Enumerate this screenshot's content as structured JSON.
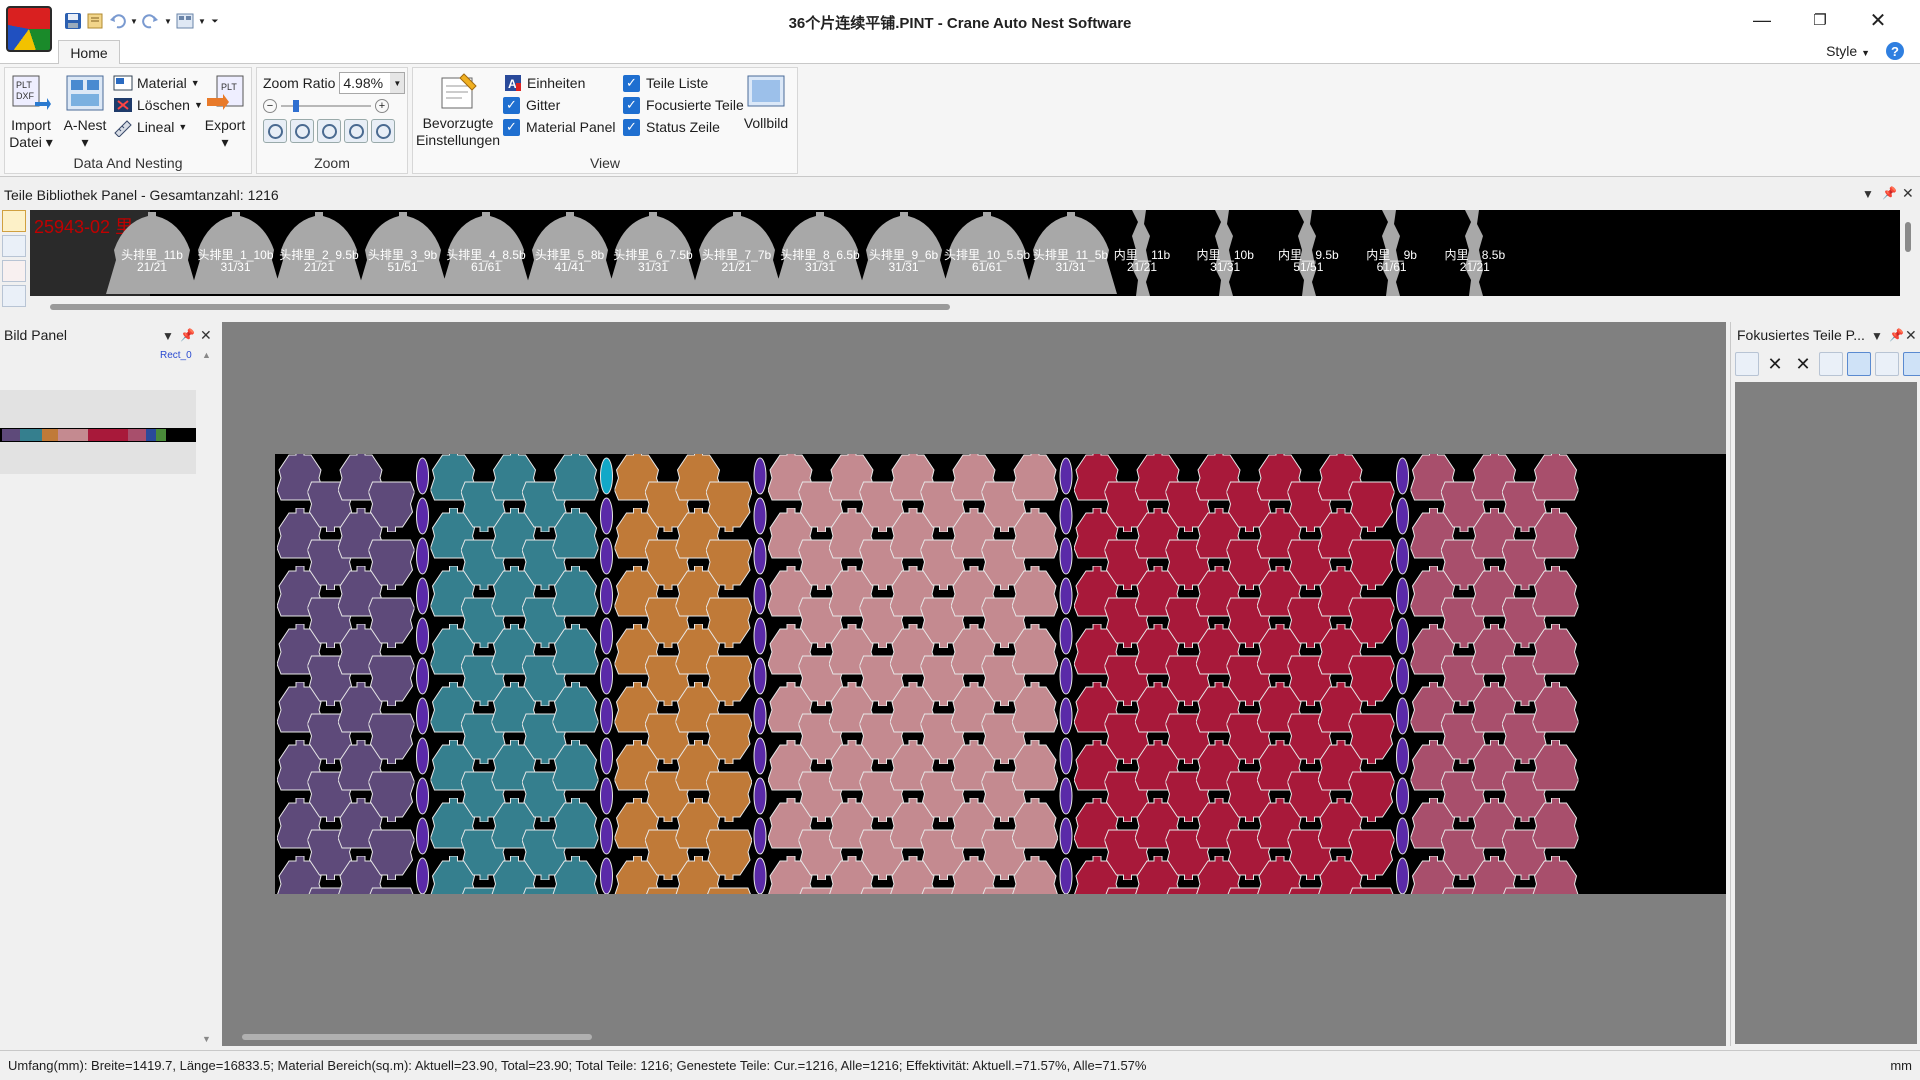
{
  "window": {
    "title": "36个片连续平铺.PINT - Crane Auto Nest Software"
  },
  "ribbon": {
    "tab": "Home",
    "style_label": "Style",
    "data_nesting": {
      "label": "Data And Nesting",
      "import_line1": "Import",
      "import_line2": "Datei",
      "anest": "A-Nest",
      "material": "Material",
      "loeschen": "Löschen",
      "lineal": "Lineal",
      "export": "Export"
    },
    "zoom": {
      "label": "Zoom",
      "ratio_label": "Zoom Ratio",
      "ratio_value": "4.98%"
    },
    "view": {
      "label": "View",
      "bevorzugte_line1": "Bevorzugte",
      "bevorzugte_line2": "Einstellungen",
      "einheiten": "Einheiten",
      "gitter": "Gitter",
      "material_panel": "Material Panel",
      "teile_liste": "Teile Liste",
      "focusierte_teile": "Focusierte Teile",
      "status_zeile": "Status Zeile",
      "vollbild": "Vollbild",
      "checked": {
        "gitter": true,
        "material_panel": true,
        "teile_liste": true,
        "focusierte_teile": true,
        "status_zeile": true
      }
    }
  },
  "parts_panel": {
    "title": "Teile Bibliothek Panel - Gesamtanzahl: 1216",
    "header_label": "25943-02 里",
    "parts": [
      {
        "name": "头排里_11b",
        "count": "21/21",
        "shape": "bell"
      },
      {
        "name": "头排里_1_10b",
        "count": "31/31",
        "shape": "bell"
      },
      {
        "name": "头排里_2_9.5b",
        "count": "21/21",
        "shape": "bell"
      },
      {
        "name": "头排里_3_9b",
        "count": "51/51",
        "shape": "bell"
      },
      {
        "name": "头排里_4_8.5b",
        "count": "61/61",
        "shape": "bell"
      },
      {
        "name": "头排里_5_8b",
        "count": "41/41",
        "shape": "bell"
      },
      {
        "name": "头排里_6_7.5b",
        "count": "31/31",
        "shape": "bell"
      },
      {
        "name": "头排里_7_7b",
        "count": "21/21",
        "shape": "bell"
      },
      {
        "name": "头排里_8_6.5b",
        "count": "31/31",
        "shape": "bell"
      },
      {
        "name": "头排里_9_6b",
        "count": "31/31",
        "shape": "bell"
      },
      {
        "name": "头排里_10_5.5b",
        "count": "61/61",
        "shape": "bell"
      },
      {
        "name": "头排里_11_5b",
        "count": "31/31",
        "shape": "bell"
      },
      {
        "name": "内里__11b",
        "count": "21/21",
        "shape": "strip"
      },
      {
        "name": "内里__10b",
        "count": "31/31",
        "shape": "strip"
      },
      {
        "name": "内里__9.5b",
        "count": "51/51",
        "shape": "strip"
      },
      {
        "name": "内里__9b",
        "count": "61/61",
        "shape": "strip"
      },
      {
        "name": "内里__8.5b",
        "count": "21/21",
        "shape": "strip"
      }
    ]
  },
  "bild_panel": {
    "title": "Bild Panel",
    "rect_label": "Rect_0"
  },
  "focus_panel": {
    "title": "Fokusiertes Teile P..."
  },
  "nesting": {
    "blocks": [
      {
        "color": "#5e4a7a",
        "columns": 4
      },
      {
        "color": "#357f8e",
        "columns": 5
      },
      {
        "color": "#c07a38",
        "columns": 4
      },
      {
        "color": "#c48a90",
        "columns": 9
      },
      {
        "color": "#a8193a",
        "columns": 10
      },
      {
        "color": "#a84f6c",
        "columns": 5
      }
    ],
    "separator_colors": [
      "#12a8c8",
      "#5a2aa8"
    ]
  },
  "statusbar": {
    "text": "Umfang(mm): Breite=1419.7, Länge=16833.5; Material Bereich(sq.m): Aktuell=23.90, Total=23.90; Total Teile: 1216; Genestete Teile: Cur.=1216, Alle=1216; Effektivität: Aktuell.=71.57%, Alle=71.57%",
    "unit": "mm"
  }
}
